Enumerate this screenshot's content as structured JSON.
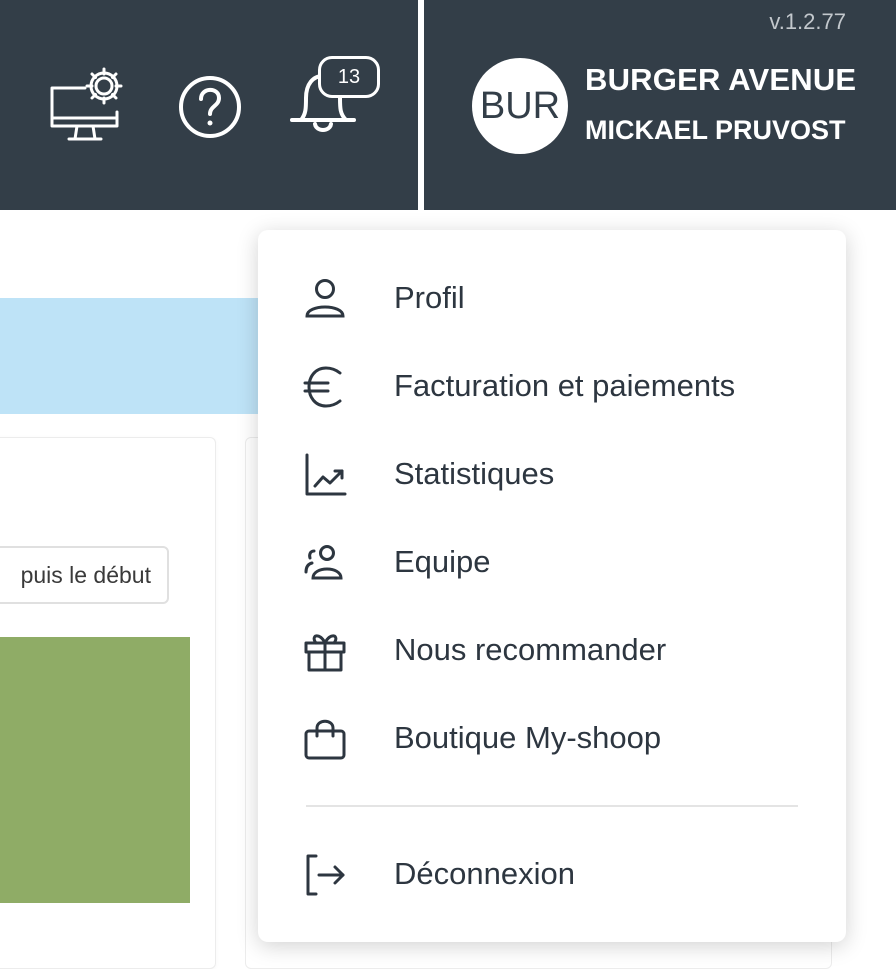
{
  "header": {
    "version": "v.1.2.77",
    "notification_count": "13",
    "avatar_initials": "BUR",
    "company_name": "BURGER AVENUE",
    "user_name": "MICKAEL PRUVOST",
    "icons": [
      "monitor-settings-icon",
      "help-icon",
      "bell-icon"
    ],
    "colors": {
      "bar": "#333e48",
      "text": "#ffffff"
    }
  },
  "background": {
    "period_button_label": "puis le début",
    "band_color": "#bee3f7",
    "block_color": "#8fac66"
  },
  "menu": {
    "items": [
      {
        "label": "Profil",
        "icon": "user-icon"
      },
      {
        "label": "Facturation et paiements",
        "icon": "euro-icon"
      },
      {
        "label": "Statistiques",
        "icon": "chart-icon"
      },
      {
        "label": "Equipe",
        "icon": "team-icon"
      },
      {
        "label": "Nous recommander",
        "icon": "gift-icon"
      },
      {
        "label": "Boutique My-shoop",
        "icon": "shopping-bag-icon"
      }
    ],
    "logout": {
      "label": "Déconnexion",
      "icon": "logout-icon"
    },
    "text_color": "#2d3640"
  }
}
